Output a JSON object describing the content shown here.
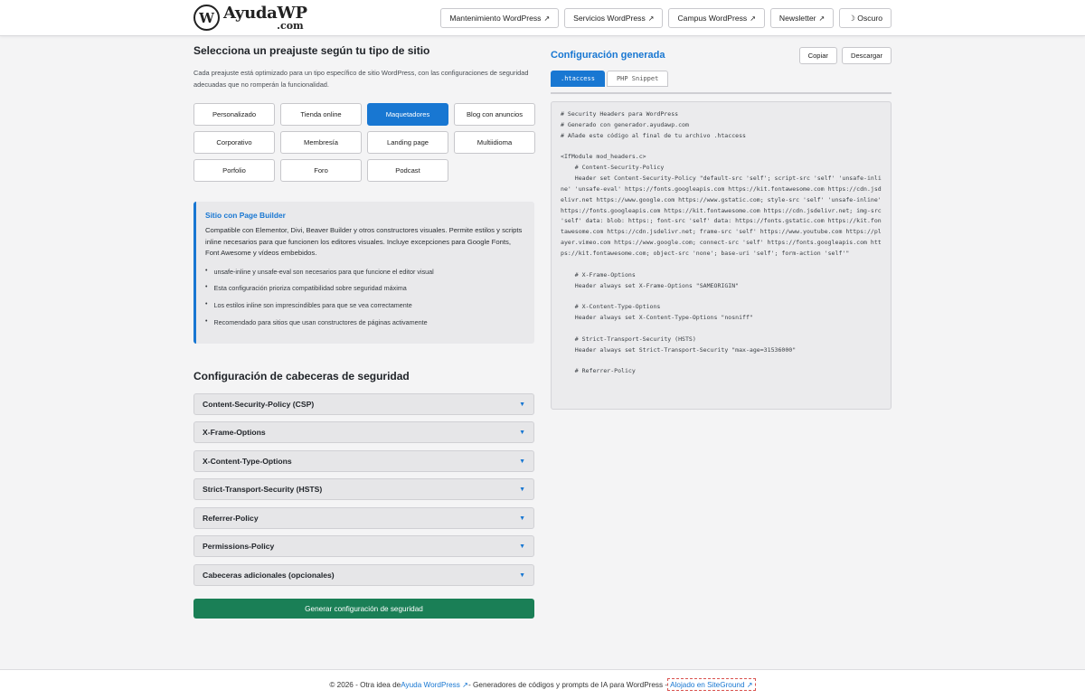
{
  "header": {
    "logo_mark": "W",
    "logo_name": "AyudaWP",
    "logo_sub": ".com",
    "nav": [
      {
        "label": "Mantenimiento WordPress",
        "ext": "↗"
      },
      {
        "label": "Servicios WordPress",
        "ext": "↗"
      },
      {
        "label": "Campus WordPress",
        "ext": "↗"
      },
      {
        "label": "Newsletter",
        "ext": "↗"
      }
    ],
    "theme_toggle": "☽ Oscuro"
  },
  "left": {
    "title": "Selecciona un preajuste según tu tipo de sitio",
    "intro": "Cada preajuste está optimizado para un tipo específico de sitio WordPress, con las configuraciones de seguridad adecuadas que no romperán la funcionalidad.",
    "presets": [
      "Personalizado",
      "Tienda online",
      "Maquetadores",
      "Blog con anuncios",
      "Corporativo",
      "Membresía",
      "Landing page",
      "Multiidioma",
      "Porfolio",
      "Foro",
      "Podcast"
    ],
    "active_preset": "Maquetadores",
    "info": {
      "title": "Sitio con Page Builder",
      "desc": "Compatible con Elementor, Divi, Beaver Builder y otros constructores visuales. Permite estilos y scripts inline necesarios para que funcionen los editores visuales. Incluye excepciones para Google Fonts, Font Awesome y vídeos embebidos.",
      "bullets": [
        "unsafe-inline y unsafe-eval son necesarios para que funcione el editor visual",
        "Esta configuración prioriza compatibilidad sobre seguridad máxima",
        "Los estilos inline son imprescindibles para que se vea correctamente",
        "Recomendado para sitios que usan constructores de páginas activamente"
      ]
    },
    "section_title": "Configuración de cabeceras de seguridad",
    "accordions": [
      "Content-Security-Policy (CSP)",
      "X-Frame-Options",
      "X-Content-Type-Options",
      "Strict-Transport-Security (HSTS)",
      "Referrer-Policy",
      "Permissions-Policy",
      "Cabeceras adicionales (opcionales)"
    ],
    "chevron": "▼",
    "generate_button": "Generar configuración de seguridad"
  },
  "right": {
    "title": "Configuración generada",
    "copy_button": "Copiar",
    "download_button": "Descargar",
    "tabs": [
      ".htaccess",
      "PHP Snippet"
    ],
    "code": "# Security Headers para WordPress\n# Generado con generador.ayudawp.com\n# Añade este código al final de tu archivo .htaccess\n\n<IfModule mod_headers.c>\n    # Content-Security-Policy\n    Header set Content-Security-Policy \"default-src 'self'; script-src 'self' 'unsafe-inline' 'unsafe-eval' https://fonts.googleapis.com https://kit.fontawesome.com https://cdn.jsdelivr.net https://www.google.com https://www.gstatic.com; style-src 'self' 'unsafe-inline' https://fonts.googleapis.com https://kit.fontawesome.com https://cdn.jsdelivr.net; img-src 'self' data: blob: https:; font-src 'self' data: https://fonts.gstatic.com https://kit.fontawesome.com https://cdn.jsdelivr.net; frame-src 'self' https://www.youtube.com https://player.vimeo.com https://www.google.com; connect-src 'self' https://fonts.googleapis.com https://kit.fontawesome.com; object-src 'none'; base-uri 'self'; form-action 'self'\"\n\n    # X-Frame-Options\n    Header always set X-Frame-Options \"SAMEORIGIN\"\n\n    # X-Content-Type-Options\n    Header always set X-Content-Type-Options \"nosniff\"\n\n    # Strict-Transport-Security (HSTS)\n    Header always set Strict-Transport-Security \"max-age=31536000\"\n\n    # Referrer-Policy"
  },
  "footer": {
    "prefix": "© 2026 - Otra idea de ",
    "link1": "Ayuda WordPress ↗",
    "middle": " - Generadores de códigos y prompts de IA para WordPress - ",
    "link2": "Alojado en SiteGround ↗"
  },
  "colors": {
    "accent": "#1877d2",
    "generate": "#1a7f56",
    "background": "#f4f4f5"
  }
}
